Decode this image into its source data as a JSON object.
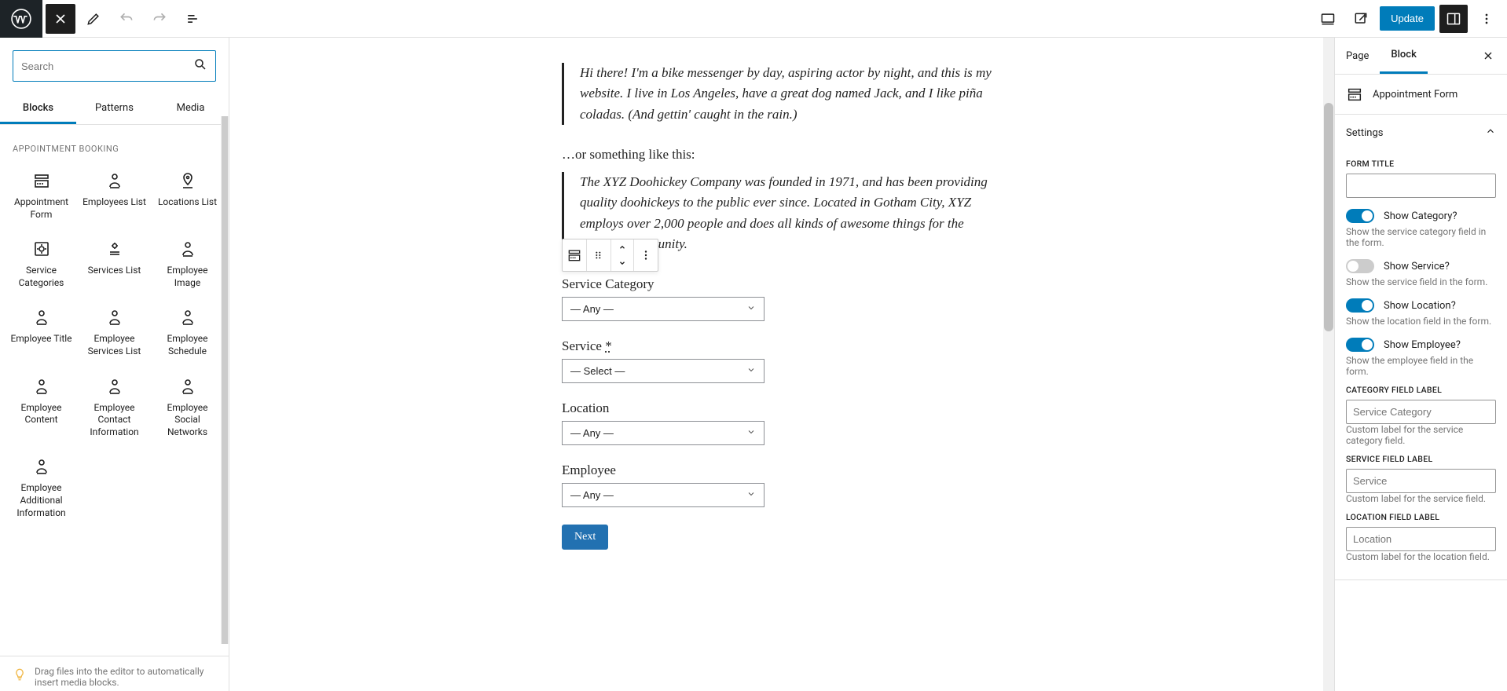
{
  "topbar": {
    "update": "Update"
  },
  "inserter": {
    "search_placeholder": "Search",
    "tabs": {
      "blocks": "Blocks",
      "patterns": "Patterns",
      "media": "Media"
    },
    "section": "APPOINTMENT BOOKING",
    "items": [
      "Appointment Form",
      "Employees List",
      "Locations List",
      "Service Categories",
      "Services List",
      "Employee Image",
      "Employee Title",
      "Employee Services List",
      "Employee Schedule",
      "Employee Content",
      "Employee Contact Information",
      "Employee Social Networks",
      "Employee Additional Information"
    ],
    "tip": "Drag files into the editor to automatically insert media blocks."
  },
  "content": {
    "quote1": "Hi there! I'm a bike messenger by day, aspiring actor by night, and this is my website. I live in Los Angeles, have a great dog named Jack, and I like piña coladas. (And gettin' caught in the rain.)",
    "or_line": "…or something like this:",
    "quote2": "The XYZ Doohickey Company was founded in 1971, and has been providing quality doohickeys to the public ever since. Located in Gotham City, XYZ employs over 2,000 people and does all kinds of awesome things for the Gotham community.",
    "form": {
      "cat_label": "Service Category",
      "cat_value": "— Any —",
      "service_label": "Service ",
      "service_req": "*",
      "service_value": "— Select —",
      "loc_label": "Location",
      "loc_value": "— Any —",
      "emp_label": "Employee",
      "emp_value": "— Any —",
      "next": "Next"
    }
  },
  "sidebar": {
    "tabs": {
      "page": "Page",
      "block": "Block"
    },
    "block_name": "Appointment Form",
    "settings_title": "Settings",
    "form_title_label": "FORM TITLE",
    "toggles": {
      "cat": {
        "label": "Show Category?",
        "help": "Show the service category field in the form.",
        "on": true
      },
      "serv": {
        "label": "Show Service?",
        "help": "Show the service field in the form.",
        "on": false
      },
      "loc": {
        "label": "Show Location?",
        "help": "Show the location field in the form.",
        "on": true
      },
      "emp": {
        "label": "Show Employee?",
        "help": "Show the employee field in the form.",
        "on": true
      }
    },
    "cat_field": {
      "label": "CATEGORY FIELD LABEL",
      "placeholder": "Service Category",
      "help": "Custom label for the service category field."
    },
    "serv_field": {
      "label": "SERVICE FIELD LABEL",
      "placeholder": "Service",
      "help": "Custom label for the service field."
    },
    "loc_field": {
      "label": "LOCATION FIELD LABEL",
      "placeholder": "Location",
      "help": "Custom label for the location field."
    }
  }
}
